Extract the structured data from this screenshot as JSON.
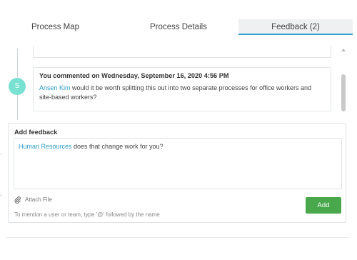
{
  "tabs": [
    {
      "label": "Process Map"
    },
    {
      "label": "Process Details"
    },
    {
      "label": "Feedback (2)"
    }
  ],
  "timeline": {
    "avatar_initial": "S",
    "comment": {
      "title": "You commented on Wednesday, September 16, 2020 4:56 PM",
      "mention": "Ansen Kim",
      "text": " would it be worth splitting this out into two separate processes for office workers and site-based workers?"
    }
  },
  "feedback": {
    "label": "Add feedback",
    "input": {
      "mention": "Human Resources",
      "text": " does that change work for you?"
    },
    "attach_label": "Attach File",
    "hint": "To mention a user or team, type '@' followed by the name",
    "add_label": "Add"
  },
  "colors": {
    "accent": "#31a0cf",
    "mention": "#2c9dcb",
    "avatar": "#78e1d2",
    "add_button": "#4aa84c"
  }
}
